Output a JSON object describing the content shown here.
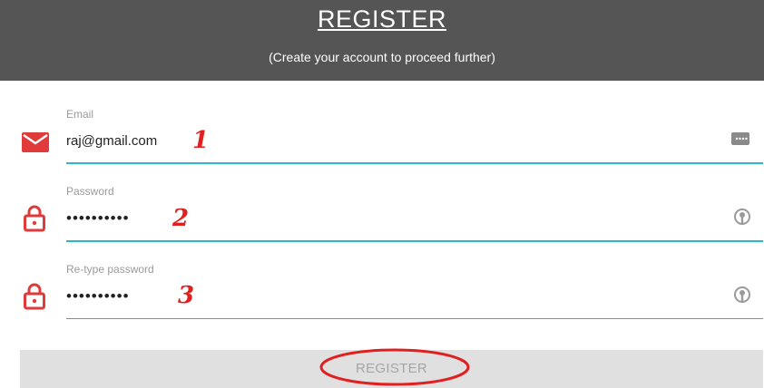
{
  "header": {
    "title": "REGISTER",
    "subtitle": "(Create your account to proceed further)"
  },
  "form": {
    "email": {
      "label": "Email",
      "value": "raj@gmail.com",
      "annotation": "1"
    },
    "password": {
      "label": "Password",
      "value": "••••••••••",
      "annotation": "2"
    },
    "retype_password": {
      "label": "Re-type password",
      "value": "••••••••••",
      "annotation": "3"
    }
  },
  "register_button": {
    "label": "REGISTER"
  },
  "icons": {
    "email": "mail-icon",
    "password": "lock-icon",
    "retype_password": "lock-icon",
    "email_autofill": "keyboard-icon",
    "password_reveal": "key-icon"
  },
  "colors": {
    "header_bg": "#555555",
    "accent_underline": "#29b6d8",
    "icon_red": "#e03a3a",
    "annotation_red": "#e02020",
    "button_bg": "#e0e0e0"
  }
}
